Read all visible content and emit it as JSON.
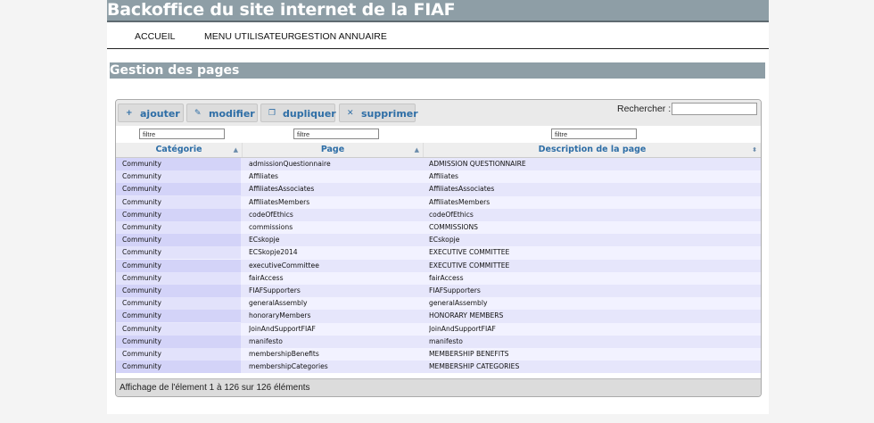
{
  "app": {
    "title": "Backoffice du site internet de la FIAF"
  },
  "nav": {
    "items": [
      "ACCUEIL",
      "MENU UTILISATEUR",
      "GESTION ANNUAIRE"
    ]
  },
  "section": {
    "title": "Gestion des pages"
  },
  "toolbar": {
    "add": "ajouter",
    "edit": "modifier",
    "duplicate": "dupliquer",
    "delete": "supprimer",
    "search_label": "Rechercher :",
    "search_value": ""
  },
  "filters": {
    "category": "filtre",
    "page": "filtre",
    "description": "filtre"
  },
  "table": {
    "columns": [
      "Catégorie",
      "Page",
      "Description de la page"
    ],
    "rows": [
      [
        "Community",
        "admissionQuestionnaire",
        "ADMISSION QUESTIONNAIRE"
      ],
      [
        "Community",
        "Affiliates",
        "Affiliates"
      ],
      [
        "Community",
        "AffiliatesAssociates",
        "AffiliatesAssociates"
      ],
      [
        "Community",
        "AffiliatesMembers",
        "AffiliatesMembers"
      ],
      [
        "Community",
        "codeOfEthics",
        "codeOfEthics"
      ],
      [
        "Community",
        "commissions",
        "COMMISSIONS"
      ],
      [
        "Community",
        "ECskopje",
        "ECskopje"
      ],
      [
        "Community",
        "ECSkopje2014",
        "EXECUTIVE COMMITTEE"
      ],
      [
        "Community",
        "executiveCommittee",
        "EXECUTIVE COMMITTEE"
      ],
      [
        "Community",
        "fairAccess",
        "fairAccess"
      ],
      [
        "Community",
        "FIAFSupporters",
        "FIAFSupporters"
      ],
      [
        "Community",
        "generalAssembly",
        "generalAssembly"
      ],
      [
        "Community",
        "honoraryMembers",
        "HONORARY MEMBERS"
      ],
      [
        "Community",
        "JoinAndSupportFIAF",
        "JoinAndSupportFIAF"
      ],
      [
        "Community",
        "manifesto",
        "manifesto"
      ],
      [
        "Community",
        "membershipBenefits",
        "MEMBERSHIP BENEFITS"
      ],
      [
        "Community",
        "membershipCategories",
        "MEMBERSHIP CATEGORIES"
      ]
    ]
  },
  "footer": {
    "info": "Affichage de l'élement 1 à 126 sur 126 éléments"
  },
  "colors": {
    "header_bg": "#8e9ea6",
    "link_blue": "#2e6ea6",
    "row_even": "#e6e6fb",
    "row_odd": "#f2f2ff"
  }
}
